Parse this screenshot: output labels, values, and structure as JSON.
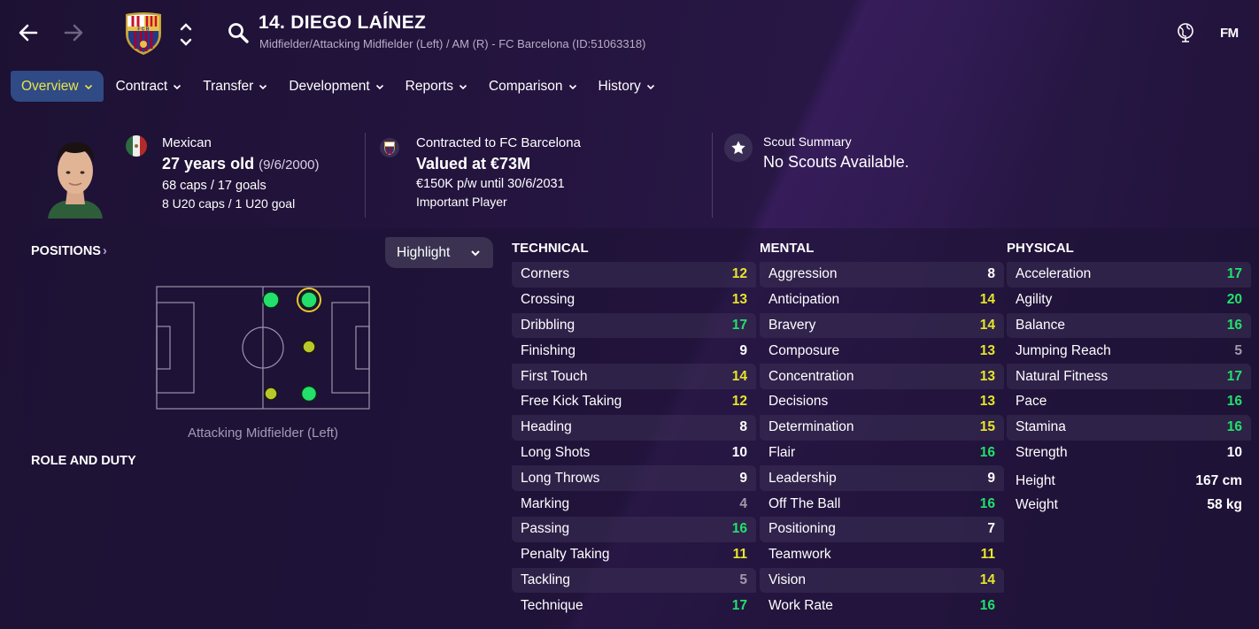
{
  "header": {
    "player_title": "14. DIEGO LAÍNEZ",
    "player_subtitle": "Midfielder/Attacking Midfielder (Left) / AM (R) - FC Barcelona (ID:51063318)",
    "logo": "FM"
  },
  "tabs": [
    {
      "label": "Overview",
      "active": true
    },
    {
      "label": "Contract"
    },
    {
      "label": "Transfer"
    },
    {
      "label": "Development"
    },
    {
      "label": "Reports"
    },
    {
      "label": "Comparison"
    },
    {
      "label": "History"
    }
  ],
  "summary": {
    "nationality": "Mexican",
    "age": "27 years old",
    "dob": "(9/6/2000)",
    "caps": "68 caps / 17 goals",
    "u20_caps": "8 U20 caps / 1 U20 goal",
    "contract_status": "Contracted to FC Barcelona",
    "value": "Valued at €73M",
    "wage": "€150K p/w until 30/6/2031",
    "squad_status": "Important Player",
    "scout_title": "Scout Summary",
    "scout_text": "No Scouts Available."
  },
  "positions": {
    "header": "POSITIONS",
    "highlight_label": "Highlight",
    "position_label": "Attacking Midfielder (Left)",
    "role_header": "ROLE AND DUTY"
  },
  "colors": {
    "accent_yellow": "#e8e34a",
    "value_green": "#22e06b",
    "value_yellow": "#e6e62a",
    "value_white": "#ffffff",
    "value_grey": "#a09aaa",
    "tab_active": "#2f4a85"
  },
  "attributes": {
    "technical": {
      "header": "TECHNICAL",
      "items": [
        {
          "name": "Corners",
          "value": "12",
          "tier": "yellow"
        },
        {
          "name": "Crossing",
          "value": "13",
          "tier": "yellow"
        },
        {
          "name": "Dribbling",
          "value": "17",
          "tier": "green"
        },
        {
          "name": "Finishing",
          "value": "9",
          "tier": "white"
        },
        {
          "name": "First Touch",
          "value": "14",
          "tier": "yellow"
        },
        {
          "name": "Free Kick Taking",
          "value": "12",
          "tier": "yellow"
        },
        {
          "name": "Heading",
          "value": "8",
          "tier": "white"
        },
        {
          "name": "Long Shots",
          "value": "10",
          "tier": "white"
        },
        {
          "name": "Long Throws",
          "value": "9",
          "tier": "white"
        },
        {
          "name": "Marking",
          "value": "4",
          "tier": "grey"
        },
        {
          "name": "Passing",
          "value": "16",
          "tier": "green"
        },
        {
          "name": "Penalty Taking",
          "value": "11",
          "tier": "yellow"
        },
        {
          "name": "Tackling",
          "value": "5",
          "tier": "grey"
        },
        {
          "name": "Technique",
          "value": "17",
          "tier": "green"
        }
      ]
    },
    "mental": {
      "header": "MENTAL",
      "items": [
        {
          "name": "Aggression",
          "value": "8",
          "tier": "white"
        },
        {
          "name": "Anticipation",
          "value": "14",
          "tier": "yellow"
        },
        {
          "name": "Bravery",
          "value": "14",
          "tier": "yellow"
        },
        {
          "name": "Composure",
          "value": "13",
          "tier": "yellow"
        },
        {
          "name": "Concentration",
          "value": "13",
          "tier": "yellow"
        },
        {
          "name": "Decisions",
          "value": "13",
          "tier": "yellow"
        },
        {
          "name": "Determination",
          "value": "15",
          "tier": "yellow"
        },
        {
          "name": "Flair",
          "value": "16",
          "tier": "green"
        },
        {
          "name": "Leadership",
          "value": "9",
          "tier": "white"
        },
        {
          "name": "Off The Ball",
          "value": "16",
          "tier": "green"
        },
        {
          "name": "Positioning",
          "value": "7",
          "tier": "white"
        },
        {
          "name": "Teamwork",
          "value": "11",
          "tier": "yellow"
        },
        {
          "name": "Vision",
          "value": "14",
          "tier": "yellow"
        },
        {
          "name": "Work Rate",
          "value": "16",
          "tier": "green"
        }
      ]
    },
    "physical": {
      "header": "PHYSICAL",
      "items": [
        {
          "name": "Acceleration",
          "value": "17",
          "tier": "green"
        },
        {
          "name": "Agility",
          "value": "20",
          "tier": "green"
        },
        {
          "name": "Balance",
          "value": "16",
          "tier": "green"
        },
        {
          "name": "Jumping Reach",
          "value": "5",
          "tier": "grey"
        },
        {
          "name": "Natural Fitness",
          "value": "17",
          "tier": "green"
        },
        {
          "name": "Pace",
          "value": "16",
          "tier": "green"
        },
        {
          "name": "Stamina",
          "value": "16",
          "tier": "green"
        },
        {
          "name": "Strength",
          "value": "10",
          "tier": "white"
        }
      ],
      "extras": [
        {
          "name": "Height",
          "value": "167 cm"
        },
        {
          "name": "Weight",
          "value": "58 kg"
        }
      ]
    }
  }
}
